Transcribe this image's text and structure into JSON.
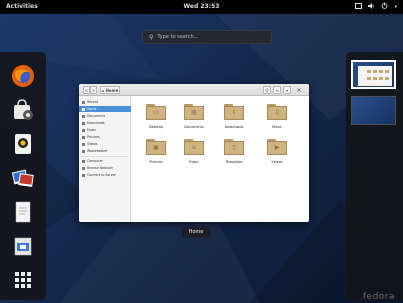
{
  "topbar": {
    "activities": "Activities",
    "clock": "Wed 23:53",
    "tray_icons": [
      "screen-icon",
      "volume-icon",
      "power-icon"
    ]
  },
  "search": {
    "placeholder": "Type to search..."
  },
  "dash": {
    "apps": [
      {
        "name": "firefox-icon"
      },
      {
        "name": "software-icon"
      },
      {
        "name": "rhythmbox-icon"
      },
      {
        "name": "photos-icon"
      },
      {
        "name": "document-icon"
      },
      {
        "name": "files-icon"
      },
      {
        "name": "app-grid-icon"
      }
    ]
  },
  "window": {
    "title": "Home",
    "toolbar": {
      "back": "<",
      "forward": ">",
      "path": "Home",
      "search": "Q",
      "view": "≡",
      "menu": "▾",
      "close": "×"
    },
    "sidebar": [
      {
        "label": "Recent",
        "selected": false
      },
      {
        "label": "Home",
        "selected": true
      },
      {
        "label": "Documents",
        "selected": false
      },
      {
        "label": "Downloads",
        "selected": false
      },
      {
        "label": "Music",
        "selected": false
      },
      {
        "label": "Pictures",
        "selected": false
      },
      {
        "label": "Videos",
        "selected": false
      },
      {
        "label": "Wastebasket",
        "selected": false
      },
      {
        "label": "Computer",
        "selected": false
      },
      {
        "label": "Browse Network",
        "selected": false
      },
      {
        "label": "Connect to Server",
        "selected": false
      }
    ],
    "files": [
      {
        "label": "Desktop",
        "emblem": "▭"
      },
      {
        "label": "Documents",
        "emblem": "▤"
      },
      {
        "label": "Downloads",
        "emblem": "⇩"
      },
      {
        "label": "Music",
        "emblem": "♫"
      },
      {
        "label": "Pictures",
        "emblem": "▣"
      },
      {
        "label": "Public",
        "emblem": "⌂"
      },
      {
        "label": "Templates",
        "emblem": "▯"
      },
      {
        "label": "Videos",
        "emblem": "▶"
      }
    ]
  },
  "window_label": "Home",
  "watermark": "fedora",
  "colors": {
    "topbar": "#000000",
    "selection": "#4a90d9",
    "folder": "#cfb482",
    "wallpaper": "#1c3b6e"
  }
}
